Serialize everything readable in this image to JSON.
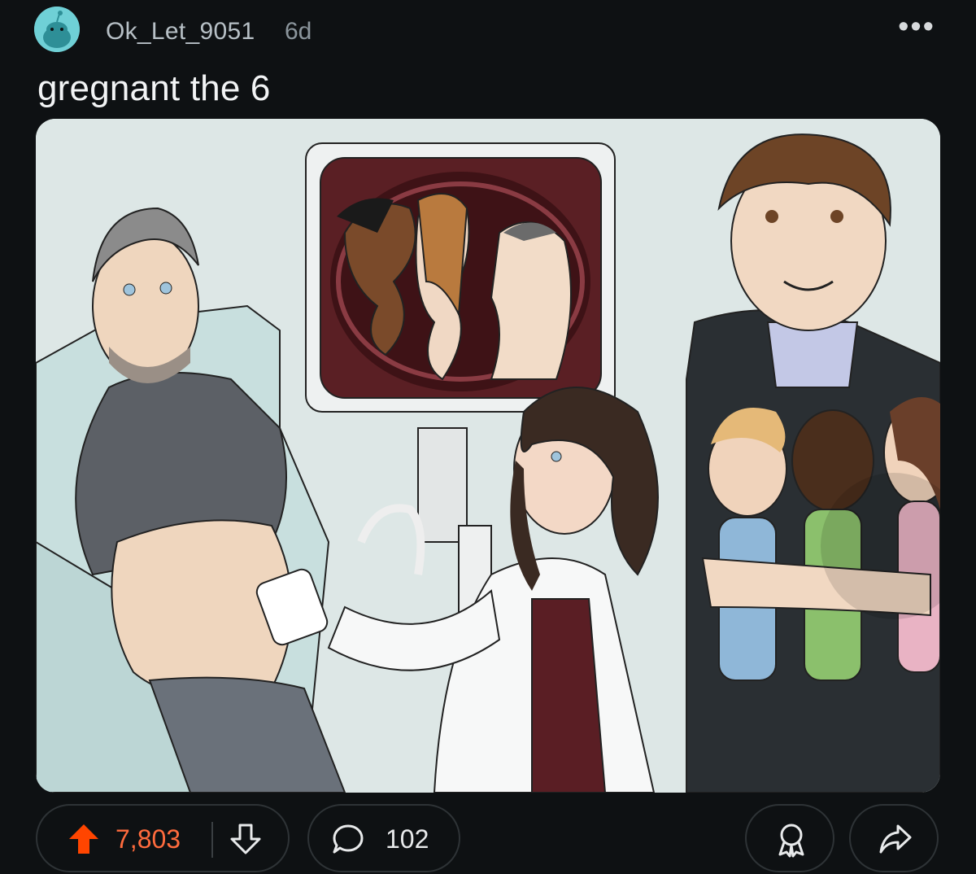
{
  "post": {
    "username": "Ok_Let_9051",
    "age": "6d",
    "more_label": "•••",
    "title": "gregnant the 6"
  },
  "image": {
    "watermark_text": ""
  },
  "actions": {
    "upvote_count": "7,803",
    "comment_count": "102",
    "upvote_icon": "arrow-up-icon",
    "downvote_icon": "arrow-down-icon",
    "comment_icon": "speech-bubble-icon",
    "award_icon": "award-icon",
    "share_icon": "share-icon"
  },
  "colors": {
    "background": "#0e1113",
    "upvote_active": "#ff4500",
    "avatar": "#6fd0d6",
    "pill_border": "#2e3336"
  }
}
